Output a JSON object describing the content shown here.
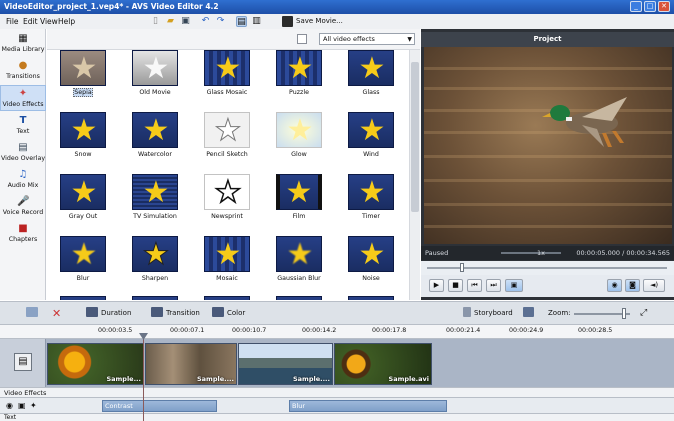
{
  "window": {
    "title": "VideoEditor_project_1.vep4* - AVS Video Editor 4.2",
    "min": "_",
    "max": "□",
    "close": "✕"
  },
  "menu": [
    "File",
    "Edit",
    "View",
    "Help"
  ],
  "toolbar": {
    "save_movie": "Save Movie..."
  },
  "sidebar": [
    {
      "label": "Media Library",
      "icon": "media-library-icon"
    },
    {
      "label": "Transitions",
      "icon": "transitions-icon"
    },
    {
      "label": "Video Effects",
      "icon": "video-effects-icon",
      "active": true
    },
    {
      "label": "Text",
      "icon": "text-icon"
    },
    {
      "label": "Video Overlay",
      "icon": "video-overlay-icon"
    },
    {
      "label": "Audio Mix",
      "icon": "audio-mix-icon"
    },
    {
      "label": "Voice Record",
      "icon": "voice-record-icon"
    },
    {
      "label": "Chapters",
      "icon": "chapters-icon"
    }
  ],
  "effects": {
    "filter": "All video effects",
    "items": [
      "Sepia",
      "Old Movie",
      "Glass Mosaic",
      "Puzzle",
      "Glass",
      "Snow",
      "Watercolor",
      "Pencil Sketch",
      "Glow",
      "Wind",
      "Gray Out",
      "TV Simulation",
      "Newsprint",
      "Film",
      "Timer",
      "Blur",
      "Sharpen",
      "Mosaic",
      "Gaussian Blur",
      "Noise"
    ],
    "selected": "Sepia"
  },
  "preview": {
    "title": "Project",
    "status": "Paused",
    "speed": "1x",
    "time": "00:00:05.000 / 00:00:34.565",
    "seek_fraction": 0.145
  },
  "timeline": {
    "buttons": {
      "duration": "Duration",
      "transition": "Transition",
      "color": "Color",
      "storyboard": "Storyboard",
      "zoom": "Zoom:"
    },
    "ruler": [
      "00:00:03.5",
      "00:00:07.1",
      "00:00:10.7",
      "00:00:14.2",
      "00:00:17.8",
      "00:00:21.4",
      "00:00:24.9",
      "00:00:28.5"
    ],
    "clips": [
      "Sample...",
      "Sample....",
      "Sample....",
      "Sample.avi"
    ],
    "fx_track_label": "Video Effects",
    "fx_clips": [
      "Contrast",
      "Blur"
    ],
    "text_track_label": "Text"
  },
  "colors": {
    "accent": "#2f6fd0",
    "star": "#f6cb19",
    "effect_bg": "#263f86",
    "timeline": "#aab5c6"
  }
}
